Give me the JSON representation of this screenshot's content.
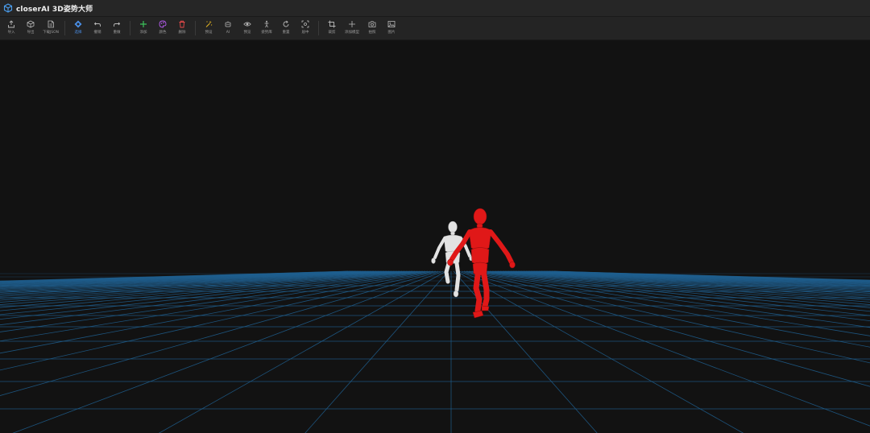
{
  "app": {
    "title": "closerAI 3D姿势大师"
  },
  "toolbar": {
    "groups": [
      [
        {
          "name": "import-button",
          "icon": "upload-icon",
          "label": "导入",
          "color": "#b8b8b8"
        },
        {
          "name": "export-button",
          "icon": "cube-icon",
          "label": "导出",
          "color": "#b8b8b8"
        },
        {
          "name": "download-button",
          "icon": "file-icon",
          "label": "下载JSON",
          "color": "#b8b8b8"
        }
      ],
      [
        {
          "name": "select-button",
          "icon": "select-diamond-icon",
          "label": "选择",
          "color": "#4a8fe8",
          "active": true
        },
        {
          "name": "undo-button",
          "icon": "undo-icon",
          "label": "撤销",
          "color": "#b8b8b8"
        },
        {
          "name": "redo-button",
          "icon": "redo-icon",
          "label": "重做",
          "color": "#b8b8b8"
        }
      ],
      [
        {
          "name": "add-button",
          "icon": "plus-icon",
          "label": "添加",
          "color": "#3cc35a"
        },
        {
          "name": "color-button",
          "icon": "palette-icon",
          "label": "颜色",
          "color": "#b65cf0"
        },
        {
          "name": "delete-button",
          "icon": "trash-icon",
          "label": "删除",
          "color": "#e84a4a"
        }
      ],
      [
        {
          "name": "magic-button",
          "icon": "magic-wand-icon",
          "label": "预设",
          "color": "#e8b923"
        },
        {
          "name": "ai-button",
          "icon": "robot-icon",
          "label": "AI",
          "color": "#b8b8b8"
        },
        {
          "name": "preview-button",
          "icon": "eye-icon",
          "label": "预览",
          "color": "#b8b8b8"
        },
        {
          "name": "pose-button",
          "icon": "figure-icon",
          "label": "姿势库",
          "color": "#b8b8b8"
        },
        {
          "name": "reset-button",
          "icon": "reset-icon",
          "label": "重置",
          "color": "#b8b8b8"
        },
        {
          "name": "focus-button",
          "icon": "focus-icon",
          "label": "居中",
          "color": "#b8b8b8"
        }
      ],
      [
        {
          "name": "crop-button",
          "icon": "crop-icon",
          "label": "裁剪",
          "color": "#b8b8b8"
        },
        {
          "name": "add-model-button",
          "icon": "plus-thin-icon",
          "label": "添加模型",
          "color": "#b8b8b8"
        },
        {
          "name": "screenshot-button",
          "icon": "camera-icon",
          "label": "拍照",
          "color": "#b8b8b8"
        },
        {
          "name": "image-button",
          "icon": "image-icon",
          "label": "图片",
          "color": "#b8b8b8"
        }
      ]
    ]
  },
  "scene": {
    "background": "#121212",
    "grid_color": "#1f5f8f",
    "figures": [
      {
        "name": "white-mannequin",
        "color": "#e2e2e2"
      },
      {
        "name": "red-mannequin",
        "color": "#e01818"
      }
    ]
  }
}
